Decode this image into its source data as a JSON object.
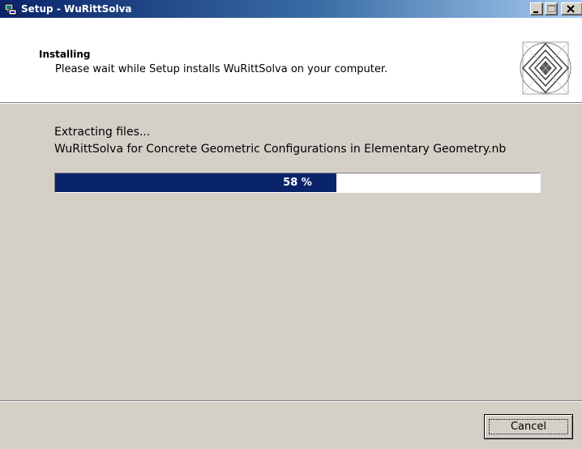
{
  "window": {
    "title": "Setup - WuRittSolva",
    "icon": "setup-computer-icon"
  },
  "caption_buttons": {
    "minimize": "minimize-icon",
    "maximize": "maximize-icon",
    "close": "close-icon"
  },
  "header": {
    "title": "Installing",
    "description": "Please wait while Setup installs WuRittSolva on your computer.",
    "logo": "wuritt-logo"
  },
  "body": {
    "status": "Extracting files...",
    "filename": "WuRittSolva for Concrete Geometric Configurations in Elementary Geometry.nb"
  },
  "progress": {
    "fraction": 0.58,
    "label": "58 %",
    "fill_color": "#0a246a"
  },
  "footer": {
    "cancel_label": "Cancel"
  }
}
